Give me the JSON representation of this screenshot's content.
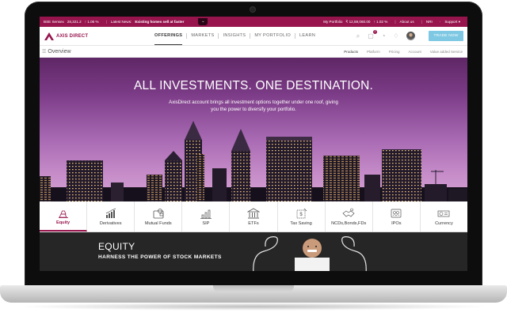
{
  "ticker": {
    "index_label": "BSE Sensex",
    "index_value": "28,321.2",
    "index_change": "↑ 1.06 %",
    "news_label": "Latest News:",
    "news_text": "Existing homes sell at faster",
    "portfolio_label": "My Portfolio",
    "portfolio_value": "₹ 12,59,060.00",
    "portfolio_change": "↑ 1.02 %",
    "about_us": "About us",
    "nri": "NRI",
    "support": "Support ▾"
  },
  "logo": {
    "text": "AXIS DIRECT"
  },
  "nav": {
    "items": [
      "OFFERINGS",
      "MARKETS",
      "INSIGHTS",
      "MY PORTFOLIO",
      "LEARN"
    ],
    "trade_button": "TRADE NOW",
    "notification_count": "2"
  },
  "subnav": {
    "overview": "Overview",
    "links": [
      "Products",
      "Platform",
      "Pricing",
      "Account",
      "Value added Service"
    ]
  },
  "hero": {
    "title": "ALL INVESTMENTS. ONE DESTINATION.",
    "subtitle": "AxisDirect  account brings all investment options together under one roof, giving you the power to diversify your portfolio."
  },
  "products": [
    {
      "label": "Equity",
      "icon": "gold-bars-icon"
    },
    {
      "label": "Derivatives",
      "icon": "bar-chart-icon"
    },
    {
      "label": "Mutual Funds",
      "icon": "wallet-icon"
    },
    {
      "label": "SIP",
      "icon": "rising-bars-icon"
    },
    {
      "label": "ETFs",
      "icon": "bank-icon"
    },
    {
      "label": "Tax Saving",
      "icon": "tax-document-icon"
    },
    {
      "label": "NCDs,Bonds,FDs",
      "icon": "handshake-icon"
    },
    {
      "label": "IPOs",
      "icon": "users-icon"
    },
    {
      "label": "Currency",
      "icon": "currency-note-icon"
    }
  ],
  "equity": {
    "title": "EQUITY",
    "subtitle": "HARNESS THE POWER OF STOCK MARKETS"
  },
  "colors": {
    "brand": "#97144d",
    "trade_button": "#7ec8e3",
    "equity_band": "#262626"
  }
}
